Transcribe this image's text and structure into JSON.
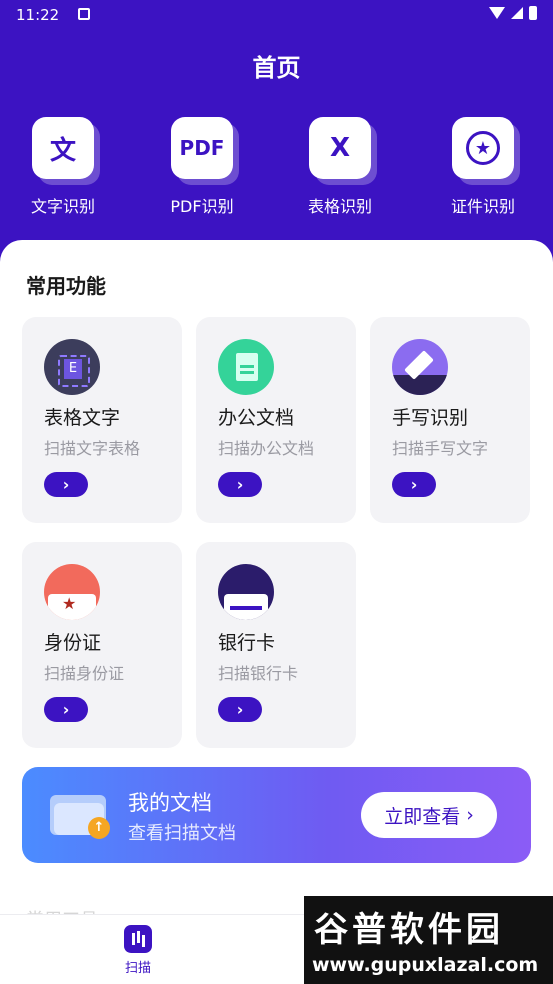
{
  "status_bar": {
    "time": "11:22"
  },
  "header": {
    "title": "首页"
  },
  "quick_tools": [
    {
      "label": "文字识别",
      "glyph": "文",
      "icon": "text-recognition-icon"
    },
    {
      "label": "PDF识别",
      "glyph": "PDF",
      "icon": "pdf-icon"
    },
    {
      "label": "表格识别",
      "glyph": "X",
      "icon": "excel-icon"
    },
    {
      "label": "证件识别",
      "glyph": "★",
      "icon": "certificate-icon"
    }
  ],
  "section": {
    "title": "常用功能"
  },
  "cards": [
    {
      "title": "表格文字",
      "sub": "扫描文字表格",
      "glyph": "E",
      "icon": "table-text-icon"
    },
    {
      "title": "办公文档",
      "sub": "扫描办公文档",
      "icon": "office-doc-icon"
    },
    {
      "title": "手写识别",
      "sub": "扫描手写文字",
      "icon": "handwriting-icon"
    },
    {
      "title": "身份证",
      "sub": "扫描身份证",
      "glyph": "★",
      "icon": "id-card-icon"
    },
    {
      "title": "银行卡",
      "sub": "扫描银行卡",
      "icon": "bank-card-icon"
    }
  ],
  "arrow_glyph": "›",
  "banner": {
    "title": "我的文档",
    "sub": "查看扫描文档",
    "button": "立即查看",
    "button_arrow": "›",
    "badge": "↑"
  },
  "partial_section": {
    "title": "常用工具"
  },
  "bottom_nav": [
    {
      "label": "扫描",
      "icon": "scan-icon"
    }
  ],
  "watermark": {
    "title": "谷普软件园",
    "url": "www.gupuxlazal.com"
  },
  "colors": {
    "primary": "#3c13c2",
    "card_bg": "#f3f3f6",
    "banner_start": "#4b8cff",
    "banner_end": "#8b5cf6"
  }
}
